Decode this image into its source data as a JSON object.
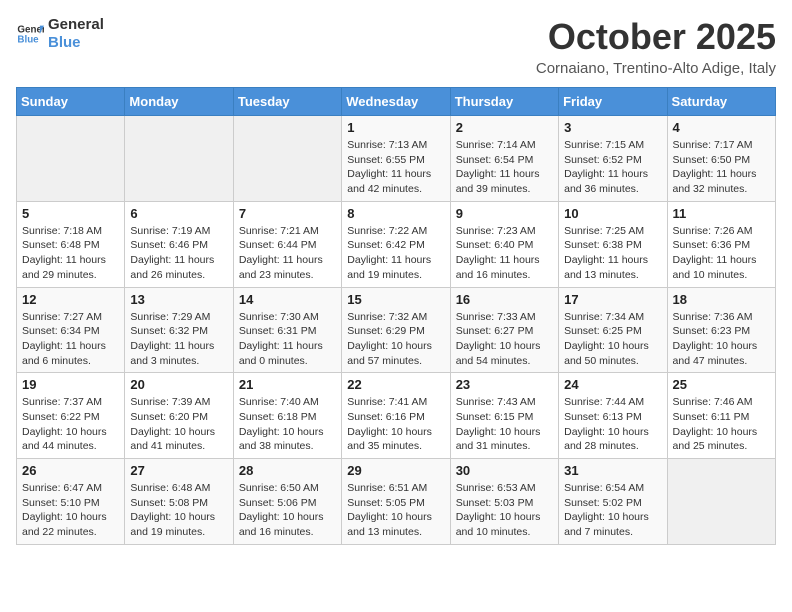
{
  "header": {
    "logo_line1": "General",
    "logo_line2": "Blue",
    "month": "October 2025",
    "location": "Cornaiano, Trentino-Alto Adige, Italy"
  },
  "weekdays": [
    "Sunday",
    "Monday",
    "Tuesday",
    "Wednesday",
    "Thursday",
    "Friday",
    "Saturday"
  ],
  "weeks": [
    [
      {
        "day": "",
        "info": ""
      },
      {
        "day": "",
        "info": ""
      },
      {
        "day": "",
        "info": ""
      },
      {
        "day": "1",
        "info": "Sunrise: 7:13 AM\nSunset: 6:55 PM\nDaylight: 11 hours\nand 42 minutes."
      },
      {
        "day": "2",
        "info": "Sunrise: 7:14 AM\nSunset: 6:54 PM\nDaylight: 11 hours\nand 39 minutes."
      },
      {
        "day": "3",
        "info": "Sunrise: 7:15 AM\nSunset: 6:52 PM\nDaylight: 11 hours\nand 36 minutes."
      },
      {
        "day": "4",
        "info": "Sunrise: 7:17 AM\nSunset: 6:50 PM\nDaylight: 11 hours\nand 32 minutes."
      }
    ],
    [
      {
        "day": "5",
        "info": "Sunrise: 7:18 AM\nSunset: 6:48 PM\nDaylight: 11 hours\nand 29 minutes."
      },
      {
        "day": "6",
        "info": "Sunrise: 7:19 AM\nSunset: 6:46 PM\nDaylight: 11 hours\nand 26 minutes."
      },
      {
        "day": "7",
        "info": "Sunrise: 7:21 AM\nSunset: 6:44 PM\nDaylight: 11 hours\nand 23 minutes."
      },
      {
        "day": "8",
        "info": "Sunrise: 7:22 AM\nSunset: 6:42 PM\nDaylight: 11 hours\nand 19 minutes."
      },
      {
        "day": "9",
        "info": "Sunrise: 7:23 AM\nSunset: 6:40 PM\nDaylight: 11 hours\nand 16 minutes."
      },
      {
        "day": "10",
        "info": "Sunrise: 7:25 AM\nSunset: 6:38 PM\nDaylight: 11 hours\nand 13 minutes."
      },
      {
        "day": "11",
        "info": "Sunrise: 7:26 AM\nSunset: 6:36 PM\nDaylight: 11 hours\nand 10 minutes."
      }
    ],
    [
      {
        "day": "12",
        "info": "Sunrise: 7:27 AM\nSunset: 6:34 PM\nDaylight: 11 hours\nand 6 minutes."
      },
      {
        "day": "13",
        "info": "Sunrise: 7:29 AM\nSunset: 6:32 PM\nDaylight: 11 hours\nand 3 minutes."
      },
      {
        "day": "14",
        "info": "Sunrise: 7:30 AM\nSunset: 6:31 PM\nDaylight: 11 hours\nand 0 minutes."
      },
      {
        "day": "15",
        "info": "Sunrise: 7:32 AM\nSunset: 6:29 PM\nDaylight: 10 hours\nand 57 minutes."
      },
      {
        "day": "16",
        "info": "Sunrise: 7:33 AM\nSunset: 6:27 PM\nDaylight: 10 hours\nand 54 minutes."
      },
      {
        "day": "17",
        "info": "Sunrise: 7:34 AM\nSunset: 6:25 PM\nDaylight: 10 hours\nand 50 minutes."
      },
      {
        "day": "18",
        "info": "Sunrise: 7:36 AM\nSunset: 6:23 PM\nDaylight: 10 hours\nand 47 minutes."
      }
    ],
    [
      {
        "day": "19",
        "info": "Sunrise: 7:37 AM\nSunset: 6:22 PM\nDaylight: 10 hours\nand 44 minutes."
      },
      {
        "day": "20",
        "info": "Sunrise: 7:39 AM\nSunset: 6:20 PM\nDaylight: 10 hours\nand 41 minutes."
      },
      {
        "day": "21",
        "info": "Sunrise: 7:40 AM\nSunset: 6:18 PM\nDaylight: 10 hours\nand 38 minutes."
      },
      {
        "day": "22",
        "info": "Sunrise: 7:41 AM\nSunset: 6:16 PM\nDaylight: 10 hours\nand 35 minutes."
      },
      {
        "day": "23",
        "info": "Sunrise: 7:43 AM\nSunset: 6:15 PM\nDaylight: 10 hours\nand 31 minutes."
      },
      {
        "day": "24",
        "info": "Sunrise: 7:44 AM\nSunset: 6:13 PM\nDaylight: 10 hours\nand 28 minutes."
      },
      {
        "day": "25",
        "info": "Sunrise: 7:46 AM\nSunset: 6:11 PM\nDaylight: 10 hours\nand 25 minutes."
      }
    ],
    [
      {
        "day": "26",
        "info": "Sunrise: 6:47 AM\nSunset: 5:10 PM\nDaylight: 10 hours\nand 22 minutes."
      },
      {
        "day": "27",
        "info": "Sunrise: 6:48 AM\nSunset: 5:08 PM\nDaylight: 10 hours\nand 19 minutes."
      },
      {
        "day": "28",
        "info": "Sunrise: 6:50 AM\nSunset: 5:06 PM\nDaylight: 10 hours\nand 16 minutes."
      },
      {
        "day": "29",
        "info": "Sunrise: 6:51 AM\nSunset: 5:05 PM\nDaylight: 10 hours\nand 13 minutes."
      },
      {
        "day": "30",
        "info": "Sunrise: 6:53 AM\nSunset: 5:03 PM\nDaylight: 10 hours\nand 10 minutes."
      },
      {
        "day": "31",
        "info": "Sunrise: 6:54 AM\nSunset: 5:02 PM\nDaylight: 10 hours\nand 7 minutes."
      },
      {
        "day": "",
        "info": ""
      }
    ]
  ]
}
